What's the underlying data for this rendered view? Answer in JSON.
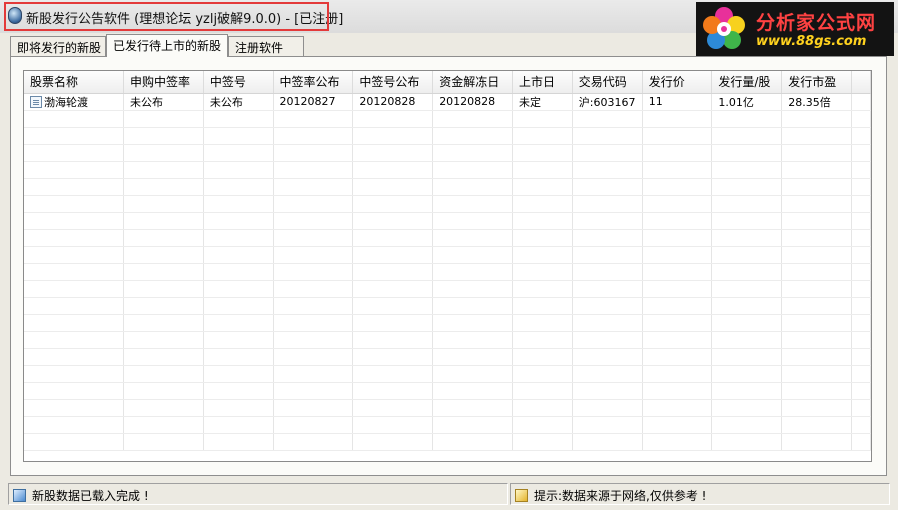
{
  "window": {
    "title": "新股发行公告软件 (理想论坛  yzlj破解9.0.0) - [已注册]"
  },
  "logo": {
    "brand_text": "分析家公式网",
    "url_text": "www.88gs.com"
  },
  "tabs": [
    {
      "label": "即将发行的新股",
      "active": false
    },
    {
      "label": "已发行待上市的新股",
      "active": true
    },
    {
      "label": "注册软件",
      "active": false
    }
  ],
  "table": {
    "columns": [
      "股票名称",
      "申购中签率",
      "中签号",
      "中签率公布",
      "中签号公布",
      "资金解冻日",
      "上市日",
      "交易代码",
      "发行价",
      "发行量/股",
      "发行市盈"
    ],
    "rows": [
      [
        "渤海轮渡",
        "未公布",
        "未公布",
        "20120827",
        "20120828",
        "20120828",
        "未定",
        "沪:603167",
        "11",
        "1.01亿",
        "28.35倍"
      ]
    ]
  },
  "status": {
    "left_text": "新股数据已载入完成 !",
    "right_text": "提示:数据来源于网络,仅供参考 !"
  },
  "colors": {
    "highlight": "#e33a3a",
    "logo_brand": "#ff4242",
    "logo_url": "#ffd21e"
  }
}
